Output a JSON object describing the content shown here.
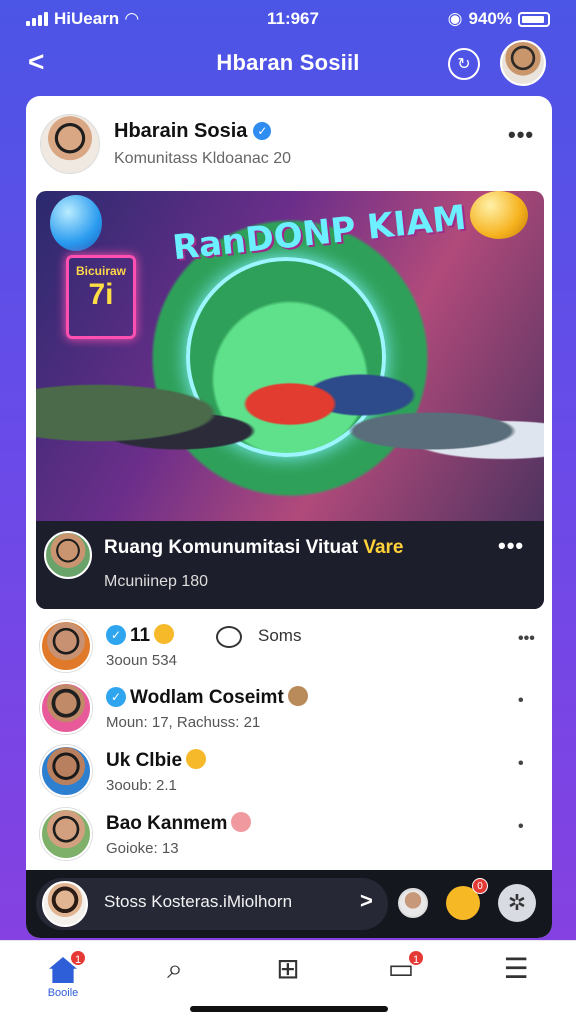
{
  "status": {
    "carrier": "HiUearn",
    "time": "11:967",
    "battery": "940%"
  },
  "nav": {
    "back": "<",
    "title": "Hbaran Sosiil"
  },
  "post": {
    "author": "Hbarain Sosia",
    "subtitle": "Komunitass Kldoanac 20",
    "more": "•••",
    "image": {
      "game_title": "RanDONP KIAM",
      "sign_text": "Bicuiraw",
      "sign_big": "7i"
    },
    "caption": {
      "title_main": "Ruang Komunumitasi Vituat ",
      "title_highlight": "Vare",
      "sub": "Mcuniinep 180",
      "more": "•••"
    }
  },
  "rows": [
    {
      "name": "11",
      "sub": "3ooun 534",
      "comment_label": "Soms",
      "more": "•••"
    },
    {
      "name": "Wodlam Coseimt",
      "sub": "Moun: 17, Rachuss: 21",
      "more": "•"
    },
    {
      "name": "Uk Clbie",
      "sub": "3ooub: 2.1",
      "more": "•"
    },
    {
      "name": "Bao Kanmem",
      "sub": "Goioke: 13",
      "more": "•"
    }
  ],
  "chat": {
    "placeholder": "Stoss Kosteras.iMiolhorn",
    "arrow": ">",
    "emoji_badge": "0"
  },
  "tabs": {
    "home_label": "Booile",
    "home_badge": "1",
    "chat_badge": "1"
  },
  "colors": {
    "accent": "#2f5fd8",
    "bg_top": "#4b55e6",
    "bg_bottom": "#8a3fe0",
    "badge": "#e53935"
  }
}
